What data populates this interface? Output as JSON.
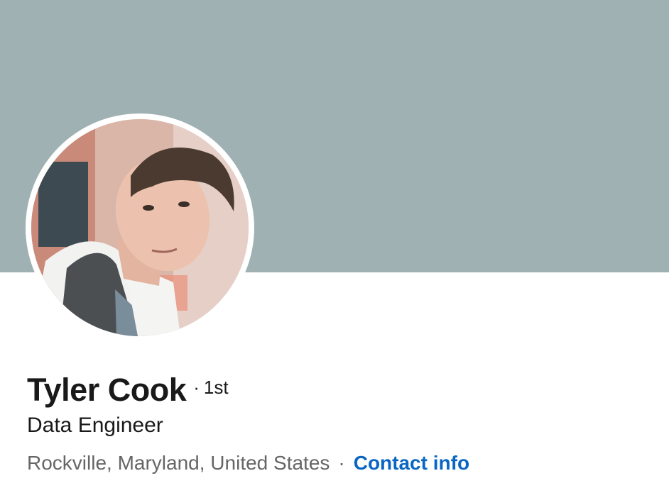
{
  "profile": {
    "name": "Tyler Cook",
    "degree_separator": "·",
    "connection_degree": "1st",
    "headline": "Data Engineer",
    "location": "Rockville, Maryland, United States",
    "location_separator": "·",
    "contact_info_label": "Contact info"
  },
  "colors": {
    "cover": "#a0b1b3",
    "link": "#0a66c2",
    "primary_text": "#191919",
    "secondary_text": "#666666"
  }
}
